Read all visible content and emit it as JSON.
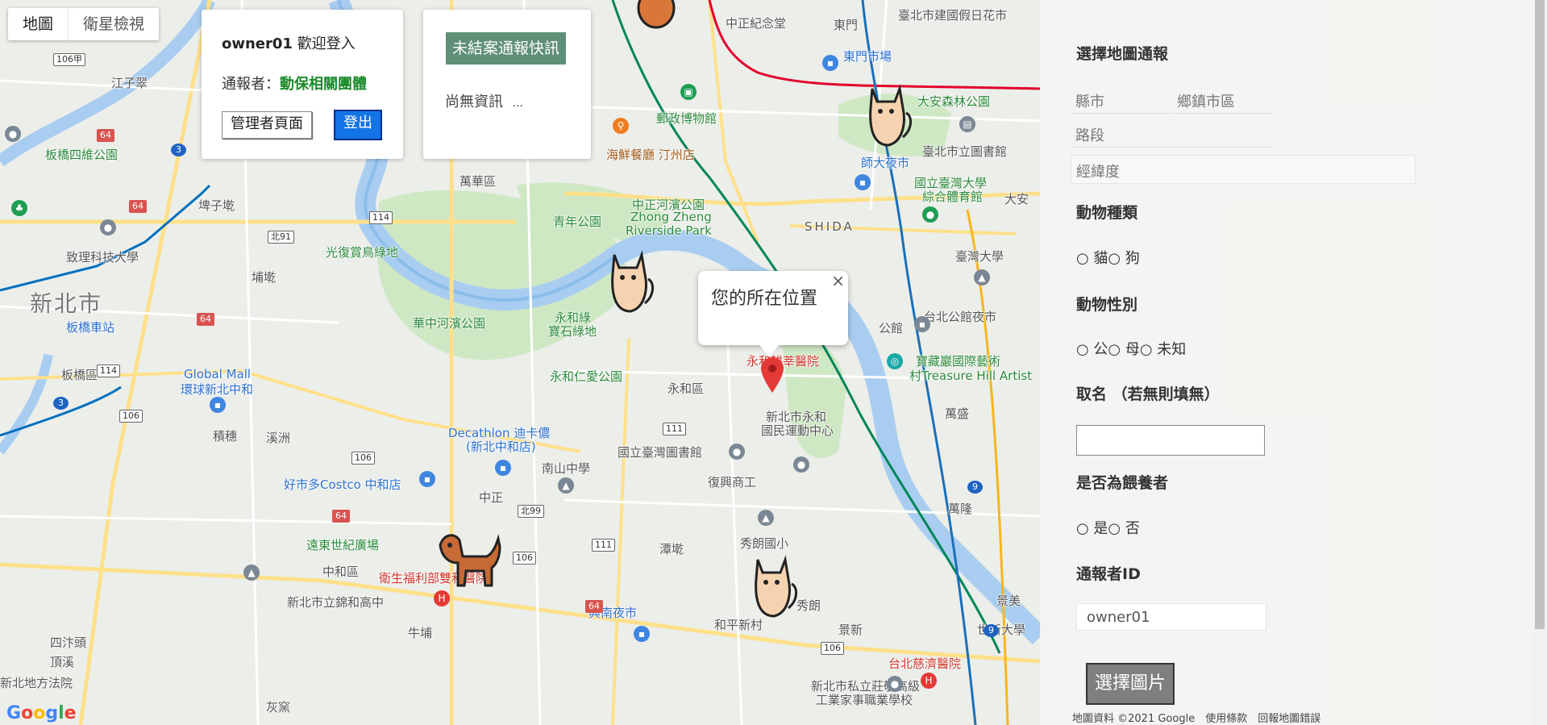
{
  "map_type": {
    "map": "地圖",
    "satellite": "衛星檢視"
  },
  "login": {
    "username": "owner01",
    "welcome": "歡迎登入",
    "reporter_label": "通報者：",
    "reporter_value": "動保相關團體",
    "admin_button": "管理者頁面",
    "logout_button": "登出"
  },
  "news": {
    "title": "未結案通報快訊",
    "empty": "尚無資訊",
    "ellipsis": "..."
  },
  "info_window": {
    "text": "您的所在位置",
    "close": "×"
  },
  "panel": {
    "title": "選擇地圖通報",
    "county_ph": "縣市",
    "town_ph": "鄉鎮市區",
    "road_ph": "路段",
    "coord_ph": "經緯度",
    "species_label": "動物種類",
    "species_options": "○ 貓○ 狗",
    "gender_label": "動物性別",
    "gender_options": "○ 公○ 母○ 未知",
    "name_label": "取名 （若無則填無）",
    "feeder_label": "是否為餵養者",
    "feeder_options": "○ 是○ 否",
    "reporter_id_label": "通報者ID",
    "reporter_id_value": "owner01",
    "upload_button": "選擇圖片"
  },
  "map_labels": {
    "l1": "新北市",
    "l2": "萬華區",
    "l3": "中正紀念堂",
    "l4": "東門",
    "l5": "東門市場",
    "l6": "郵政博物館",
    "l7": "海鮮餐廳 汀州店",
    "l8": "青年公園",
    "l9": "中正河濱公園",
    "l10": "Zhong Zheng",
    "l11": "Riverside Park",
    "l12": "大安森林公園",
    "l13": "師大夜市",
    "l14": "臺北市立圖書館",
    "l15": "國立臺灣大學",
    "l16": "綜合體育館",
    "l17": "SHIDA",
    "l18": "臺灣大學",
    "l19": "台北公館夜市",
    "l20": "公館",
    "l21": "寶藏巖國際藝術",
    "l22": "村Treasure Hill Artist",
    "l23": "萬盛",
    "l24": "光復賞鳥綠地",
    "l25": "華中河濱公園",
    "l26": "永和綠",
    "l27": "寶石綠地",
    "l28": "永和仁愛公園",
    "l29": "永和區",
    "l30": "新北市永和",
    "l31": "國民運動中心",
    "l32": "國立臺灣圖書館",
    "l33": "復興商工",
    "l34": "秀朗國小",
    "l35": "Global Mall",
    "l36": "環球新北中和",
    "l37": "Decathlon 迪卡儂",
    "l38": "(新北中和店)",
    "l39": "好市多Costco 中和店",
    "l40": "南山中學",
    "l41": "遠東世紀廣場",
    "l42": "中和區",
    "l43": "衛生福利部雙和醫院",
    "l44": "新北市立錦和高中",
    "l45": "興南夜市",
    "l46": "和平新村",
    "l47": "台北慈濟醫院",
    "l48": "新北市私立莊敬高級",
    "l49": "工業家事職業學校",
    "l50": "板橋四維公園",
    "l51": "致理科技大學",
    "l52": "板橋車站",
    "l53": "板橋區",
    "l54": "新北地方法院",
    "l55": "頂溪",
    "l56": "四汴頭",
    "l57": "牛埔",
    "l58": "灰窯",
    "l59": "永和耕莘醫院",
    "l60": "臺北市建國假日花市",
    "l61": "大安",
    "l62": "萬隆",
    "l63": "景美",
    "l64": "世新大學",
    "l65": "江子翠",
    "l66": "埔墘",
    "l67": "埤子墘",
    "l68": "溪洲",
    "l69": "積穗",
    "l70": "中正",
    "l71": "秀朗",
    "l72": "潭墘",
    "l73": "景新"
  },
  "footer": "地圖資料 ©2021 Google　使用條款　回報地圖錯誤",
  "google_logo": [
    "G",
    "o",
    "o",
    "g",
    "l",
    "e"
  ],
  "colors": {
    "panel_bg": "#f4f5f2",
    "news_title_bg": "#5f8f77",
    "logout_bg": "#1274e6",
    "reporter_value": "#1b8a2a",
    "river": "#a9cdf1",
    "park": "#cfe8c4",
    "pin": "#e53935"
  }
}
